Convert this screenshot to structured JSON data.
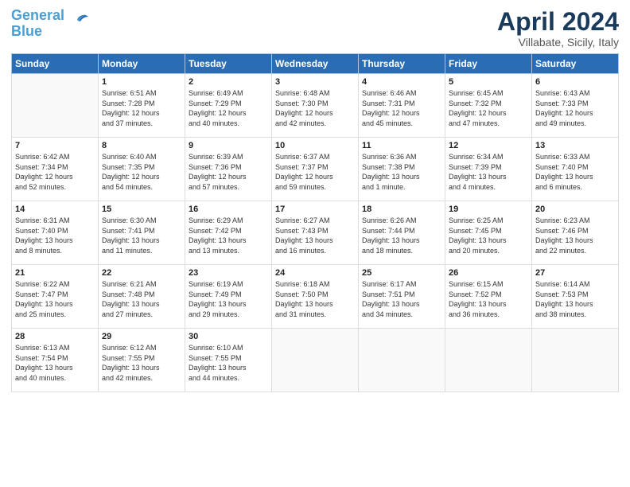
{
  "header": {
    "logo_line1": "General",
    "logo_line2": "Blue",
    "main_title": "April 2024",
    "subtitle": "Villabate, Sicily, Italy"
  },
  "days_of_week": [
    "Sunday",
    "Monday",
    "Tuesday",
    "Wednesday",
    "Thursday",
    "Friday",
    "Saturday"
  ],
  "weeks": [
    [
      {
        "num": "",
        "info": ""
      },
      {
        "num": "1",
        "info": "Sunrise: 6:51 AM\nSunset: 7:28 PM\nDaylight: 12 hours\nand 37 minutes."
      },
      {
        "num": "2",
        "info": "Sunrise: 6:49 AM\nSunset: 7:29 PM\nDaylight: 12 hours\nand 40 minutes."
      },
      {
        "num": "3",
        "info": "Sunrise: 6:48 AM\nSunset: 7:30 PM\nDaylight: 12 hours\nand 42 minutes."
      },
      {
        "num": "4",
        "info": "Sunrise: 6:46 AM\nSunset: 7:31 PM\nDaylight: 12 hours\nand 45 minutes."
      },
      {
        "num": "5",
        "info": "Sunrise: 6:45 AM\nSunset: 7:32 PM\nDaylight: 12 hours\nand 47 minutes."
      },
      {
        "num": "6",
        "info": "Sunrise: 6:43 AM\nSunset: 7:33 PM\nDaylight: 12 hours\nand 49 minutes."
      }
    ],
    [
      {
        "num": "7",
        "info": "Sunrise: 6:42 AM\nSunset: 7:34 PM\nDaylight: 12 hours\nand 52 minutes."
      },
      {
        "num": "8",
        "info": "Sunrise: 6:40 AM\nSunset: 7:35 PM\nDaylight: 12 hours\nand 54 minutes."
      },
      {
        "num": "9",
        "info": "Sunrise: 6:39 AM\nSunset: 7:36 PM\nDaylight: 12 hours\nand 57 minutes."
      },
      {
        "num": "10",
        "info": "Sunrise: 6:37 AM\nSunset: 7:37 PM\nDaylight: 12 hours\nand 59 minutes."
      },
      {
        "num": "11",
        "info": "Sunrise: 6:36 AM\nSunset: 7:38 PM\nDaylight: 13 hours\nand 1 minute."
      },
      {
        "num": "12",
        "info": "Sunrise: 6:34 AM\nSunset: 7:39 PM\nDaylight: 13 hours\nand 4 minutes."
      },
      {
        "num": "13",
        "info": "Sunrise: 6:33 AM\nSunset: 7:40 PM\nDaylight: 13 hours\nand 6 minutes."
      }
    ],
    [
      {
        "num": "14",
        "info": "Sunrise: 6:31 AM\nSunset: 7:40 PM\nDaylight: 13 hours\nand 8 minutes."
      },
      {
        "num": "15",
        "info": "Sunrise: 6:30 AM\nSunset: 7:41 PM\nDaylight: 13 hours\nand 11 minutes."
      },
      {
        "num": "16",
        "info": "Sunrise: 6:29 AM\nSunset: 7:42 PM\nDaylight: 13 hours\nand 13 minutes."
      },
      {
        "num": "17",
        "info": "Sunrise: 6:27 AM\nSunset: 7:43 PM\nDaylight: 13 hours\nand 16 minutes."
      },
      {
        "num": "18",
        "info": "Sunrise: 6:26 AM\nSunset: 7:44 PM\nDaylight: 13 hours\nand 18 minutes."
      },
      {
        "num": "19",
        "info": "Sunrise: 6:25 AM\nSunset: 7:45 PM\nDaylight: 13 hours\nand 20 minutes."
      },
      {
        "num": "20",
        "info": "Sunrise: 6:23 AM\nSunset: 7:46 PM\nDaylight: 13 hours\nand 22 minutes."
      }
    ],
    [
      {
        "num": "21",
        "info": "Sunrise: 6:22 AM\nSunset: 7:47 PM\nDaylight: 13 hours\nand 25 minutes."
      },
      {
        "num": "22",
        "info": "Sunrise: 6:21 AM\nSunset: 7:48 PM\nDaylight: 13 hours\nand 27 minutes."
      },
      {
        "num": "23",
        "info": "Sunrise: 6:19 AM\nSunset: 7:49 PM\nDaylight: 13 hours\nand 29 minutes."
      },
      {
        "num": "24",
        "info": "Sunrise: 6:18 AM\nSunset: 7:50 PM\nDaylight: 13 hours\nand 31 minutes."
      },
      {
        "num": "25",
        "info": "Sunrise: 6:17 AM\nSunset: 7:51 PM\nDaylight: 13 hours\nand 34 minutes."
      },
      {
        "num": "26",
        "info": "Sunrise: 6:15 AM\nSunset: 7:52 PM\nDaylight: 13 hours\nand 36 minutes."
      },
      {
        "num": "27",
        "info": "Sunrise: 6:14 AM\nSunset: 7:53 PM\nDaylight: 13 hours\nand 38 minutes."
      }
    ],
    [
      {
        "num": "28",
        "info": "Sunrise: 6:13 AM\nSunset: 7:54 PM\nDaylight: 13 hours\nand 40 minutes."
      },
      {
        "num": "29",
        "info": "Sunrise: 6:12 AM\nSunset: 7:55 PM\nDaylight: 13 hours\nand 42 minutes."
      },
      {
        "num": "30",
        "info": "Sunrise: 6:10 AM\nSunset: 7:55 PM\nDaylight: 13 hours\nand 44 minutes."
      },
      {
        "num": "",
        "info": ""
      },
      {
        "num": "",
        "info": ""
      },
      {
        "num": "",
        "info": ""
      },
      {
        "num": "",
        "info": ""
      }
    ]
  ]
}
